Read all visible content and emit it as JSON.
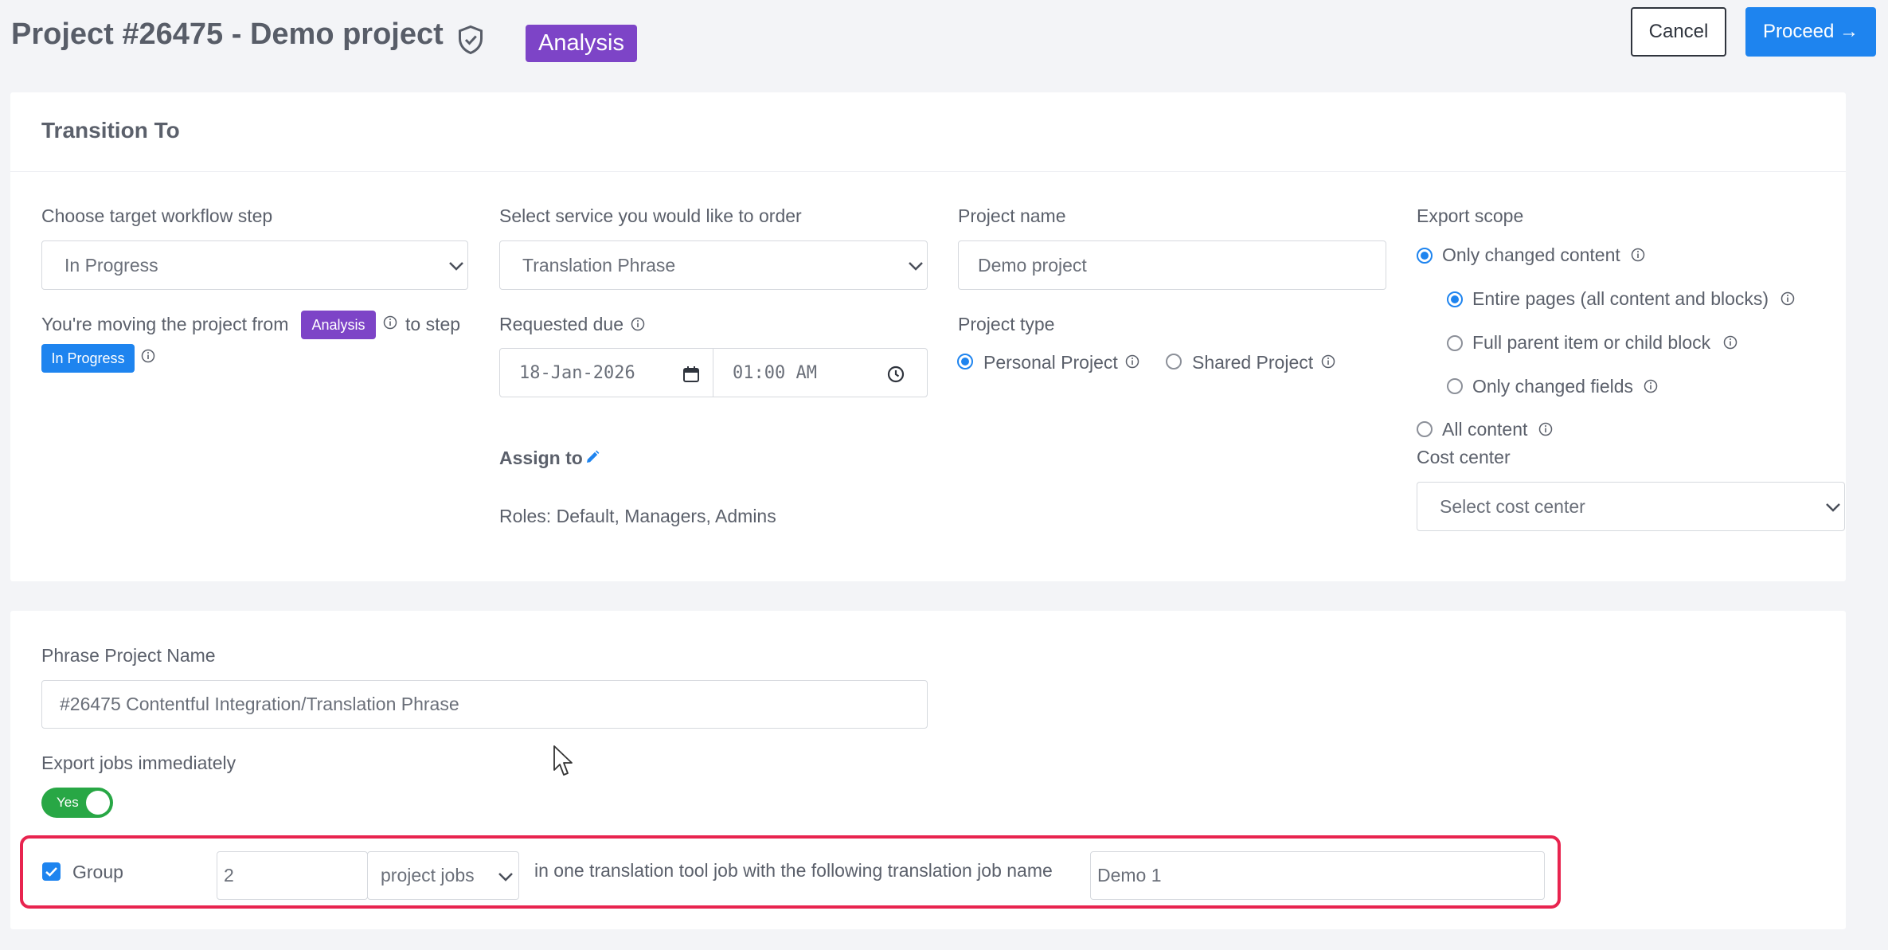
{
  "header": {
    "title": "Project #26475 - Demo project",
    "status_badge": "Analysis",
    "cancel_label": "Cancel",
    "proceed_label": "Proceed →"
  },
  "transition": {
    "title": "Transition To",
    "workflow": {
      "label": "Choose target workflow step",
      "value": "In Progress",
      "moving_prefix": "You're moving the project from",
      "from_badge": "Analysis",
      "to_step_text": "to step",
      "to_badge": "In Progress"
    },
    "service": {
      "label": "Select service you would like to order",
      "value": "Translation Phrase",
      "due_label": "Requested due",
      "due_date": "18-Jan-2026",
      "due_time": "01:00 AM",
      "assign_label": "Assign to",
      "roles_text": "Roles: Default, Managers, Admins"
    },
    "project": {
      "name_label": "Project name",
      "name_value": "Demo project",
      "type_label": "Project type",
      "type_options": [
        "Personal Project",
        "Shared Project"
      ],
      "type_selected": "Personal Project"
    },
    "export_scope": {
      "label": "Export scope",
      "only_changed": "Only changed content",
      "sub_options": [
        "Entire pages (all content and blocks)",
        "Full parent item or child block",
        "Only changed fields"
      ],
      "all_content": "All content",
      "cost_center_label": "Cost center",
      "cost_center_placeholder": "Select cost center"
    }
  },
  "phrase": {
    "name_label": "Phrase Project Name",
    "name_value": "#26475 Contentful Integration/Translation Phrase",
    "export_label": "Export jobs immediately",
    "export_toggle": "Yes",
    "group_label": "Group",
    "group_count": "2",
    "group_unit": "project jobs",
    "group_text": "in one translation tool job with the following translation job name",
    "job_name": "Demo 1"
  },
  "colors": {
    "accent": "#1e84ef",
    "purple": "#7d44c7",
    "highlight": "#e8244f",
    "toggle": "#28a745"
  }
}
